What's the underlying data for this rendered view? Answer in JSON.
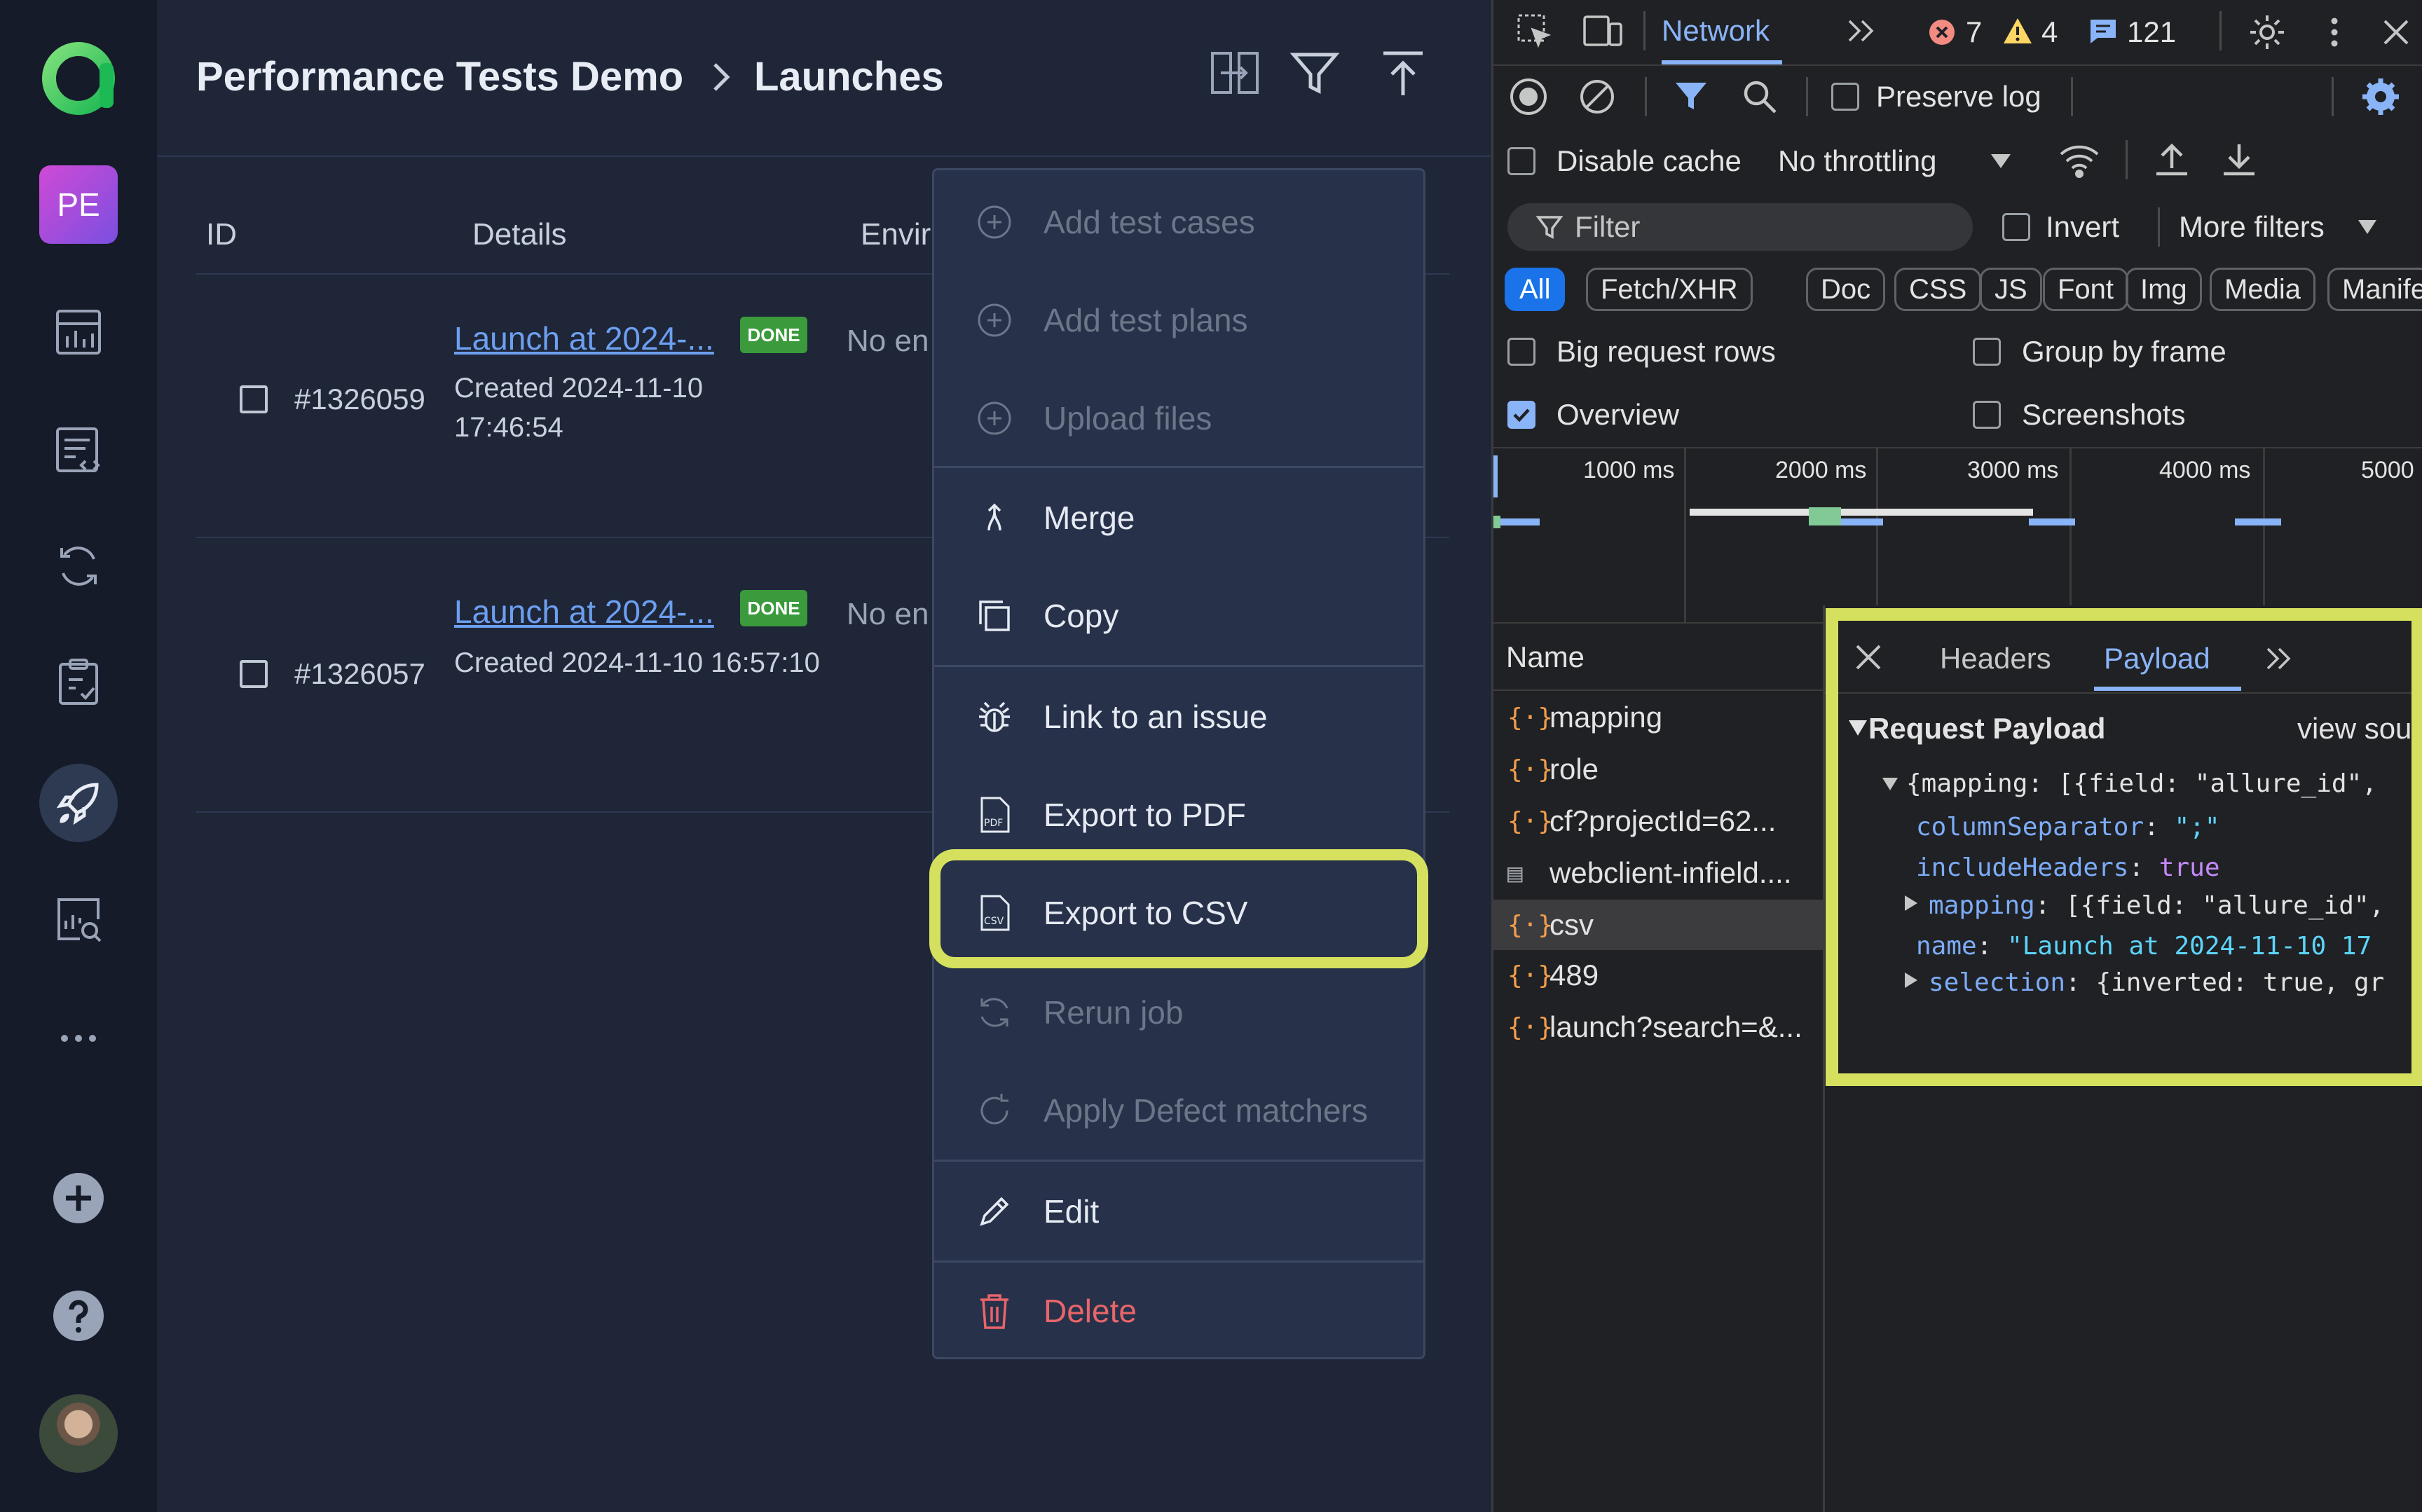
{
  "nav": {
    "project_initials": "PE",
    "items": [
      "logo-icon",
      "dashboards-icon",
      "test-cases-icon",
      "test-plans-icon",
      "jobs-icon",
      "launches-icon",
      "analytics-icon",
      "more-icon",
      "add-icon",
      "help-icon",
      "avatar"
    ]
  },
  "header": {
    "project": "Performance Tests Demo",
    "page": "Launches"
  },
  "table": {
    "columns": {
      "id": "ID",
      "details": "Details",
      "env": "Envir"
    },
    "rows": [
      {
        "id": "#1326059",
        "name": "Launch at 2024-...",
        "status": "DONE",
        "created_line1": "Created 2024-11-10",
        "created_line2": "17:46:54",
        "env": "No en"
      },
      {
        "id": "#1326057",
        "name": "Launch at 2024-...",
        "status": "DONE",
        "created_line1": "Created 2024-11-10 16:57:10",
        "created_line2": "",
        "env": "No en"
      }
    ]
  },
  "menu": {
    "add_test_cases": "Add test cases",
    "add_test_plans": "Add test plans",
    "upload_files": "Upload files",
    "merge": "Merge",
    "copy": "Copy",
    "link_issue": "Link to an issue",
    "export_pdf": "Export to PDF",
    "export_csv": "Export to CSV",
    "rerun_job": "Rerun job",
    "apply_defect": "Apply Defect matchers",
    "edit": "Edit",
    "delete": "Delete"
  },
  "devtools": {
    "tab": "Network",
    "errors": "7",
    "warnings": "4",
    "messages": "121",
    "preserve_log": "Preserve log",
    "disable_cache": "Disable cache",
    "throttling": "No throttling",
    "filter_placeholder": "Filter",
    "invert": "Invert",
    "more_filters": "More filters",
    "types": [
      "All",
      "Fetch/XHR",
      "Doc",
      "CSS",
      "JS",
      "Font",
      "Img",
      "Media",
      "Manife"
    ],
    "big_rows": "Big request rows",
    "group_frame": "Group by frame",
    "overview": "Overview",
    "screenshots": "Screenshots",
    "timeline_labels": [
      "1000 ms",
      "2000 ms",
      "3000 ms",
      "4000 ms",
      "5000"
    ],
    "name_header": "Name",
    "requests": [
      "mapping",
      "role",
      "cf?projectId=62...",
      "webclient-infield....",
      "csv",
      "489",
      "launch?search=&..."
    ],
    "detail_tabs": {
      "headers": "Headers",
      "payload": "Payload"
    },
    "payload": {
      "title": "Request Payload",
      "view_source": "view source",
      "root": "{mapping: [{field: \"allure_id\",",
      "col_sep_key": "columnSeparator",
      "col_sep_val": "\";\"",
      "inc_head_key": "includeHeaders",
      "inc_head_val": "true",
      "mapping_key": "mapping",
      "mapping_val": "[{field: \"allure_id\",",
      "name_key": "name",
      "name_val": "\"Launch at 2024-11-10 17",
      "selection_key": "selection",
      "selection_val": "{inverted: true, gr"
    }
  }
}
